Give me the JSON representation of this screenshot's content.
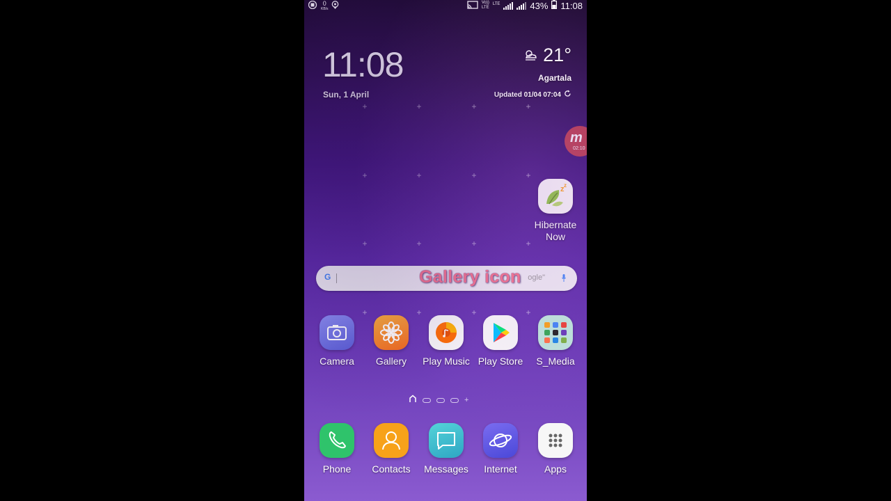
{
  "status_bar": {
    "data_rate_value": "0",
    "data_rate_unit": "KB/s",
    "volte_label": "Vo))",
    "lte_label": "LTE",
    "lte2_label": "LTE",
    "battery_text": "43%",
    "time": "11:08"
  },
  "clock_widget": {
    "time": "11:08",
    "date": "Sun, 1 April",
    "temperature": "21°",
    "city": "Agartala",
    "updated": "Updated 01/04 07:04"
  },
  "recorder_bubble": {
    "letter": "m",
    "timer": "02:10"
  },
  "hibernate": {
    "label_line1": "Hibernate",
    "label_line2": "Now"
  },
  "search": {
    "g_logo": "G",
    "hint": "ogle\""
  },
  "overlay": {
    "text": "Gallery icon"
  },
  "apps": [
    {
      "label": "Camera"
    },
    {
      "label": "Gallery"
    },
    {
      "label": "Play Music"
    },
    {
      "label": "Play Store"
    },
    {
      "label": "S_Media"
    }
  ],
  "dock": [
    {
      "label": "Phone"
    },
    {
      "label": "Contacts"
    },
    {
      "label": "Messages"
    },
    {
      "label": "Internet"
    },
    {
      "label": "Apps"
    }
  ],
  "colors": {
    "phone": "#2fc36b",
    "contacts": "#f7a21a",
    "messages": "#3fc0c8",
    "internet": "#5a5ae0",
    "camera": "#6a6ad8",
    "gallery": "#f68a1e"
  }
}
